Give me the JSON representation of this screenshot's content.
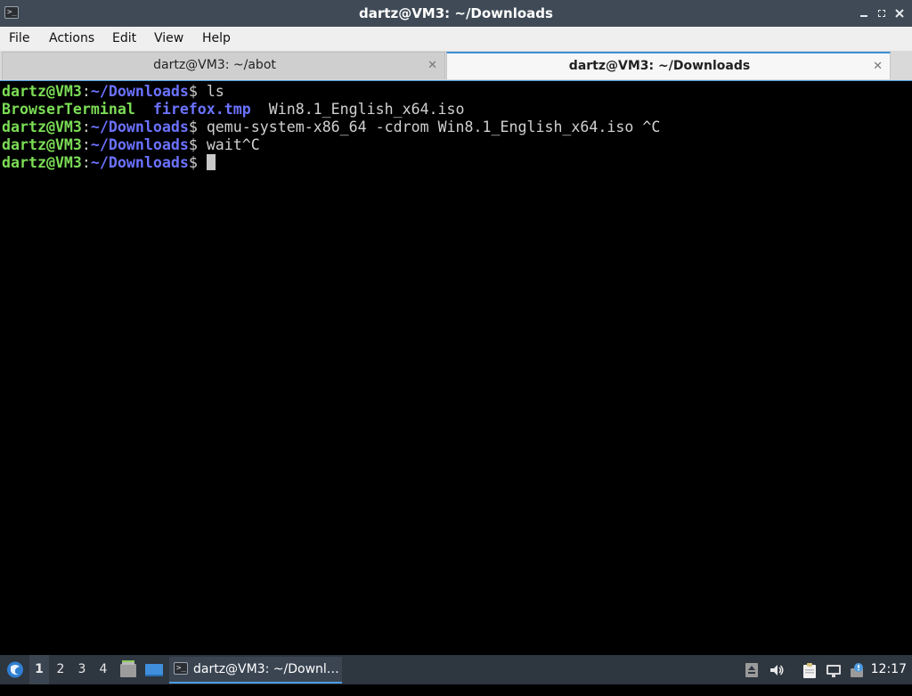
{
  "window": {
    "title": "dartz@VM3: ~/Downloads",
    "app_icon_glyph": ">_",
    "controls": [
      "minimize",
      "restore",
      "close"
    ]
  },
  "menu": {
    "items": [
      "File",
      "Actions",
      "Edit",
      "View",
      "Help"
    ]
  },
  "tabs": [
    {
      "label": "dartz@VM3: ~/abot",
      "active": false
    },
    {
      "label": "dartz@VM3: ~/Downloads",
      "active": true
    }
  ],
  "terminal": {
    "user_host": "dartz@VM3",
    "colon": ":",
    "cwd": "~/Downloads",
    "prompt_symbol": "$",
    "commands": [
      " ls",
      " qemu-system-x86_64 -cdrom Win8.1_English_x64.iso ^C",
      " wait^C"
    ],
    "ls_output": [
      {
        "name": "BrowserTerminal",
        "type": "exec"
      },
      {
        "name": "firefox.tmp",
        "type": "dir"
      },
      {
        "name": "Win8.1_English_x64.iso",
        "type": "file"
      }
    ],
    "colors": {
      "green": "#7bdc55",
      "blue": "#6b72ff",
      "text": "#d0d0d0",
      "background": "#000000"
    }
  },
  "taskbar": {
    "workspaces": [
      "1",
      "2",
      "3",
      "4"
    ],
    "active_workspace": "1",
    "task_label": "dartz@VM3: ~/Downl…",
    "clock": "12:17",
    "tray_icons": [
      "menu-logo-icon",
      "file-manager-icon",
      "desktop-icon",
      "usb-icon",
      "volume-icon",
      "clipboard-icon",
      "network-icon",
      "update-icon"
    ]
  }
}
